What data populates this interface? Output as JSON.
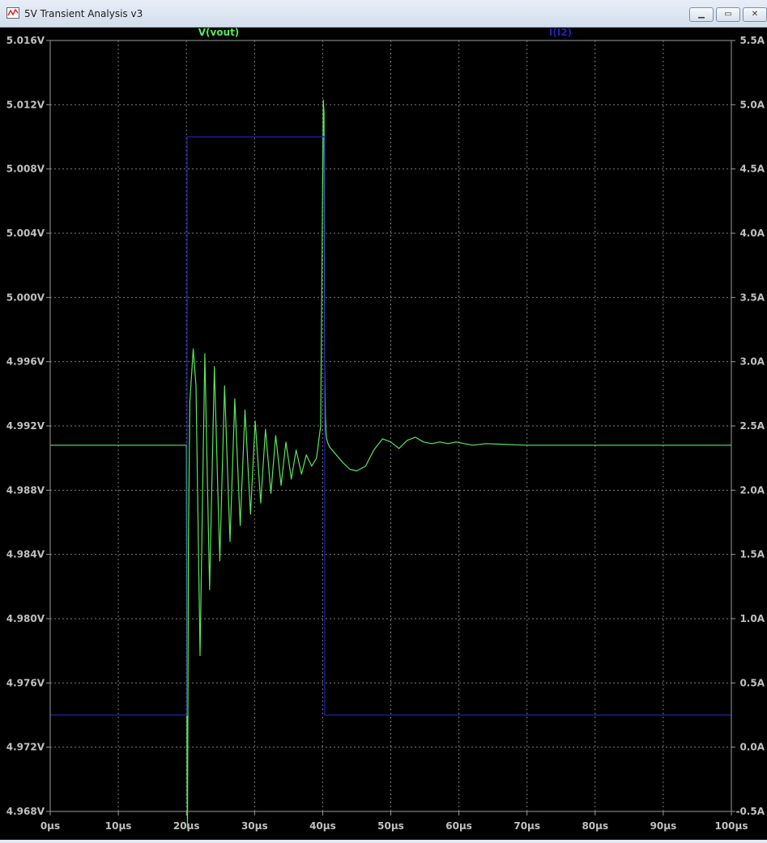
{
  "window": {
    "title": "5V Transient Analysis v3",
    "minimize_icon": "minimize-icon",
    "maximize_icon": "maximize-icon",
    "close_icon": "close-icon"
  },
  "colors": {
    "background": "#000000",
    "grid": "#7a7a7a",
    "axis_text": "#c0c0c0",
    "vout": "#5ae65a",
    "current": "#1e22b4"
  },
  "chart_data": {
    "type": "line",
    "title": "",
    "grid": true,
    "x_axis": {
      "range": [
        0,
        100
      ],
      "unit": "µs",
      "ticks": [
        "0µs",
        "10µs",
        "20µs",
        "30µs",
        "40µs",
        "50µs",
        "60µs",
        "70µs",
        "80µs",
        "90µs",
        "100µs"
      ]
    },
    "y_left": {
      "range": [
        4.968,
        5.016
      ],
      "unit": "V",
      "ticks": [
        "5.016V",
        "5.012V",
        "5.008V",
        "5.004V",
        "5.000V",
        "4.996V",
        "4.992V",
        "4.988V",
        "4.984V",
        "4.980V",
        "4.976V",
        "4.972V",
        "4.968V"
      ]
    },
    "y_right": {
      "range": [
        -0.5,
        5.5
      ],
      "unit": "A",
      "ticks": [
        "5.5A",
        "5.0A",
        "4.5A",
        "4.0A",
        "3.5A",
        "3.0A",
        "2.5A",
        "2.0A",
        "1.5A",
        "1.0A",
        "0.5A",
        "0.0A",
        "-0.5A"
      ]
    },
    "series": [
      {
        "name": "V(vout)",
        "axis": "left",
        "x": [
          0,
          20,
          20.1,
          20.15,
          20.2,
          20.3,
          20.5,
          21,
          21.4,
          22,
          22.7,
          23.4,
          24.1,
          24.9,
          25.6,
          26.4,
          27.1,
          27.9,
          28.6,
          29.4,
          30.1,
          30.9,
          31.6,
          32.4,
          33.1,
          33.9,
          34.6,
          35.4,
          36.1,
          36.9,
          37.6,
          38.4,
          39.1,
          39.7,
          40.1,
          40.2,
          40.3,
          40.4,
          40.5,
          40.6,
          40.7,
          41,
          42,
          43,
          44,
          45,
          46.3,
          47.5,
          48.8,
          50,
          51.2,
          52.4,
          53.6,
          54.8,
          56,
          57.2,
          58.4,
          59.6,
          60.8,
          62,
          64,
          70,
          100
        ],
        "y": [
          4.9908,
          4.9908,
          4.969,
          4.967,
          4.9725,
          4.985,
          4.9935,
          4.9968,
          4.9945,
          4.9777,
          4.9965,
          4.9818,
          4.9957,
          4.9836,
          4.9945,
          4.9848,
          4.9937,
          4.9858,
          4.993,
          4.9865,
          4.9923,
          4.9872,
          4.9918,
          4.9878,
          4.9914,
          4.9883,
          4.991,
          4.9887,
          4.9905,
          4.989,
          4.9902,
          4.9895,
          4.99,
          4.992,
          5.0123,
          5.0115,
          4.996,
          4.9925,
          4.9915,
          4.9912,
          4.991,
          4.9907,
          4.9902,
          4.9897,
          4.9893,
          4.9892,
          4.9895,
          4.9905,
          4.9912,
          4.991,
          4.9906,
          4.9911,
          4.9913,
          4.991,
          4.9909,
          4.991,
          4.9909,
          4.991,
          4.9909,
          4.9908,
          4.9909,
          4.9908,
          4.9908
        ]
      },
      {
        "name": "I(I2)",
        "axis": "right",
        "x": [
          0,
          20.1,
          20.1,
          40.3,
          40.3,
          100
        ],
        "y": [
          0.25,
          0.25,
          4.75,
          4.75,
          0.25,
          0.25
        ]
      }
    ]
  }
}
